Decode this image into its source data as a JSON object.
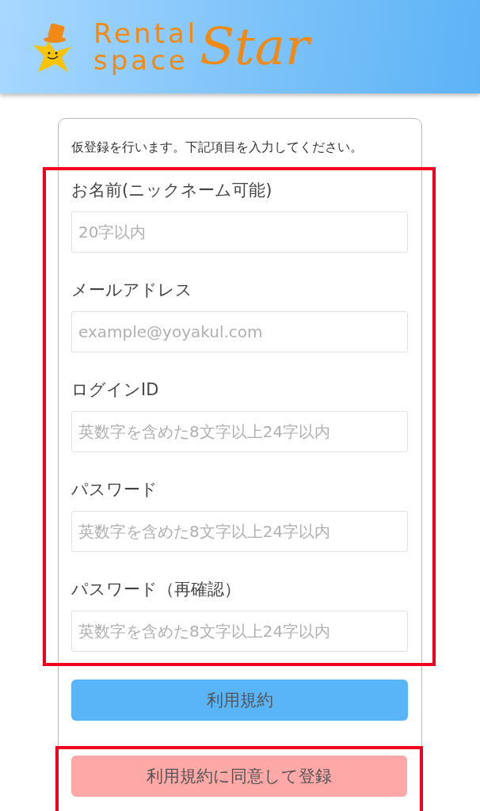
{
  "header": {
    "logo": {
      "line_1": "Rental",
      "line_2": "space",
      "big": "Star"
    }
  },
  "intro": "仮登録を行います。下記項目を入力してください。",
  "fields": [
    {
      "label": "お名前(ニックネーム可能)",
      "placeholder": "20字以内"
    },
    {
      "label": "メールアドレス",
      "placeholder": "example@yoyakul.com"
    },
    {
      "label": "ログインID",
      "placeholder": "英数字を含めた8文字以上24字以内"
    },
    {
      "label": "パスワード",
      "placeholder": "英数字を含めた8文字以上24字以内"
    },
    {
      "label": "パスワード（再確認）",
      "placeholder": "英数字を含めた8文字以上24字以内"
    }
  ],
  "buttons": [
    {
      "kind": "terms",
      "label": "利用規約"
    },
    {
      "kind": "submit",
      "label": "利用規約に同意して登録"
    }
  ]
}
